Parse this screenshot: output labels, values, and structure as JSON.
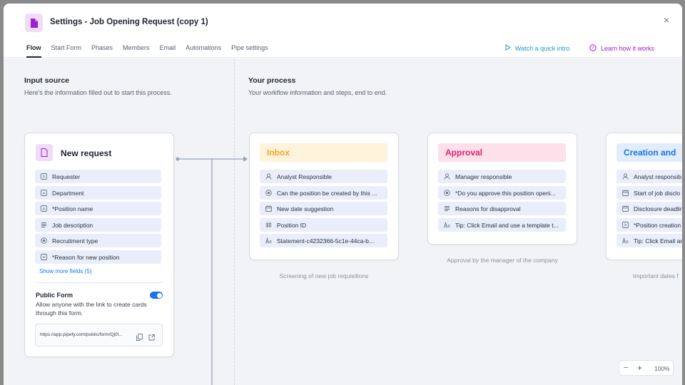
{
  "window": {
    "title": "Settings - Job Opening Request (copy 1)",
    "close_label": "×"
  },
  "tabs": [
    {
      "label": "Flow",
      "active": true
    },
    {
      "label": "Start Form"
    },
    {
      "label": "Phases"
    },
    {
      "label": "Members"
    },
    {
      "label": "Email"
    },
    {
      "label": "Automations"
    },
    {
      "label": "Pipe settings"
    }
  ],
  "header_links": {
    "intro": "Watch a quick intro",
    "learn": "Learn how it works"
  },
  "input_source": {
    "title": "Input source",
    "subtitle": "Here's the information filled out to start this process."
  },
  "your_process": {
    "title": "Your process",
    "subtitle": "Your workflow information and steps, end to end."
  },
  "start_card": {
    "title": "New request",
    "fields": [
      {
        "label": "Requester",
        "icon": "select-icon"
      },
      {
        "label": "Department",
        "icon": "text-box-icon"
      },
      {
        "label": "*Position name",
        "icon": "text-box-icon"
      },
      {
        "label": "Job description",
        "icon": "paragraph-icon"
      },
      {
        "label": "Recruitment type",
        "icon": "radio-icon"
      },
      {
        "label": "*Reason for new position",
        "icon": "dropdown-icon"
      }
    ],
    "show_more": "Show more fields (5)",
    "public_form_title": "Public Form",
    "public_form_desc": "Allow anyone with the link to create cards through this form.",
    "public_form_enabled": true,
    "form_url": "https://app.pipefy.com/public/form/Qj0l..."
  },
  "phases": [
    {
      "title": "Inbox",
      "color": "#f5a623",
      "bg": "#fff3dc",
      "caption": "Screening of new job requisitions",
      "fields": [
        {
          "label": "Analyst Responsible",
          "icon": "person-icon"
        },
        {
          "label": "Can the position be created by this ...",
          "icon": "radio-icon"
        },
        {
          "label": "New date suggestion",
          "icon": "calendar-icon"
        },
        {
          "label": "Position ID",
          "icon": "hash-icon"
        },
        {
          "label": "Statement-c4232366-5c1e-44ca-b...",
          "icon": "statement-icon"
        }
      ]
    },
    {
      "title": "Approval",
      "color": "#e0226e",
      "bg": "#fde0ea",
      "caption": "Approval by the manager of the company",
      "fields": [
        {
          "label": "Manager responsible",
          "icon": "person-icon"
        },
        {
          "label": "*Do you approve this position openi...",
          "icon": "radio-icon"
        },
        {
          "label": "Reasons for disapproval",
          "icon": "paragraph-icon"
        },
        {
          "label": "Tip: Click Email and use a template t...",
          "icon": "statement-icon"
        }
      ]
    },
    {
      "title": "Creation and",
      "color": "#1a73e8",
      "bg": "#e1ecfd",
      "caption": "Important dates f",
      "fields": [
        {
          "label": "Analyst responsib",
          "icon": "person-icon"
        },
        {
          "label": "Start of job disclo",
          "icon": "calendar-icon"
        },
        {
          "label": "Disclosure deadlin",
          "icon": "calendar-icon"
        },
        {
          "label": "*Position creation",
          "icon": "select-icon"
        },
        {
          "label": "Tip: Click Email an",
          "icon": "statement-icon"
        }
      ]
    }
  ],
  "zoom": {
    "minus": "−",
    "plus": "+",
    "level": "100%"
  }
}
